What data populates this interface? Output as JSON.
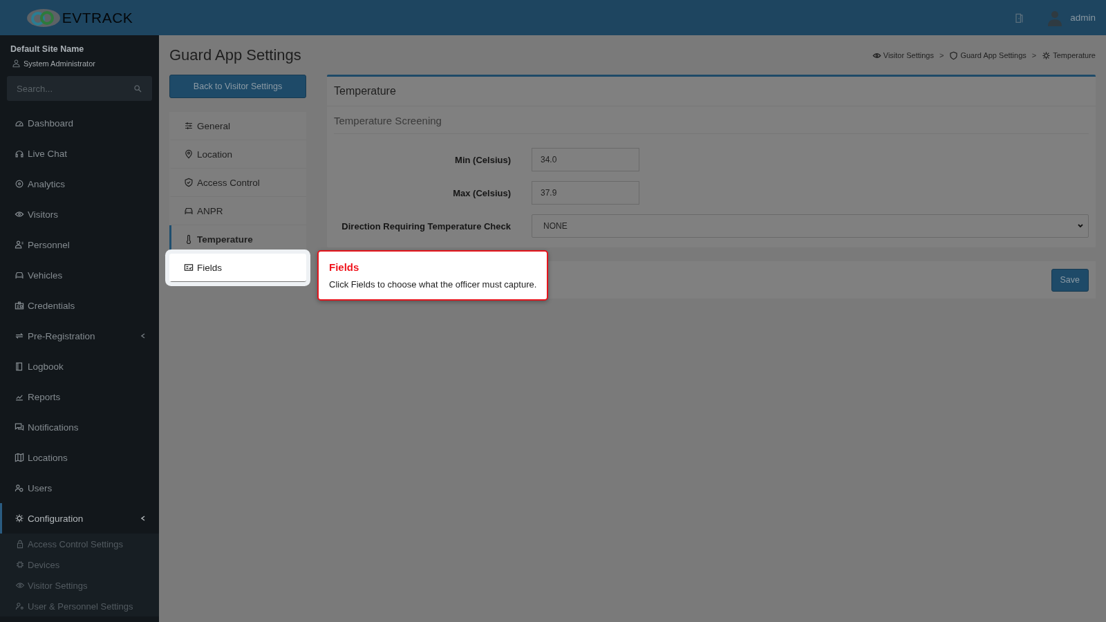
{
  "logo": {
    "text": "**EV**TRACK"
  },
  "topbar": {
    "user": "admin"
  },
  "sidebar": {
    "site": "Default Site Name",
    "role": "System Administrator",
    "search": {
      "placeholder": "Search..."
    },
    "items": [
      {
        "label": "Dashboard",
        "selected": false
      },
      {
        "label": "Live Chat",
        "selected": false
      },
      {
        "label": "Analytics",
        "selected": false
      },
      {
        "label": "Visitors",
        "selected": false
      },
      {
        "label": "Personnel",
        "selected": false
      },
      {
        "label": "Vehicles",
        "selected": false
      },
      {
        "label": "Credentials",
        "selected": false
      },
      {
        "label": "Pre-Registration",
        "selected": false,
        "expanded": false
      },
      {
        "label": "Logbook",
        "selected": false
      },
      {
        "label": "Reports",
        "selected": false
      },
      {
        "label": "Notifications",
        "selected": false
      },
      {
        "label": "Locations",
        "selected": false
      },
      {
        "label": "Users",
        "selected": false
      },
      {
        "label": "Configuration",
        "selected": true,
        "expanded": true,
        "children": [
          {
            "label": "Access Control Settings"
          },
          {
            "label": "Devices"
          },
          {
            "label": "Visitor Settings"
          },
          {
            "label": "User & Personnel Settings"
          }
        ]
      }
    ]
  },
  "page": {
    "title": "Guard App Settings",
    "breadcrumb": [
      {
        "label": "Visitor Settings",
        "separator": ">"
      },
      {
        "label": "Guard App Settings",
        "separator": ">"
      },
      {
        "label": "Temperature"
      }
    ],
    "back_button": "Back to Visitor Settings",
    "tabs": [
      {
        "label": "General",
        "selected": false,
        "spotlight": false
      },
      {
        "label": "Location",
        "selected": false,
        "spotlight": false
      },
      {
        "label": "Access Control",
        "selected": false,
        "spotlight": false
      },
      {
        "label": "ANPR",
        "selected": false,
        "spotlight": false
      },
      {
        "label": "Temperature",
        "selected": true,
        "spotlight": false
      },
      {
        "label": "Fields",
        "selected": false,
        "spotlight": true
      }
    ],
    "card": {
      "title": "Temperature",
      "section": "Temperature Screening",
      "fields": [
        {
          "kind": "input",
          "label": "Min (Celsius)",
          "value": "34.0"
        },
        {
          "kind": "input",
          "label": "Max (Celsius)",
          "value": "37.9"
        },
        {
          "kind": "select",
          "label": "Direction Requiring Temperature Check",
          "value": "NONE"
        }
      ]
    },
    "save_button": "Save"
  },
  "tour": {
    "title": "Fields",
    "text": "Click Fields to choose what the officer must capture."
  }
}
